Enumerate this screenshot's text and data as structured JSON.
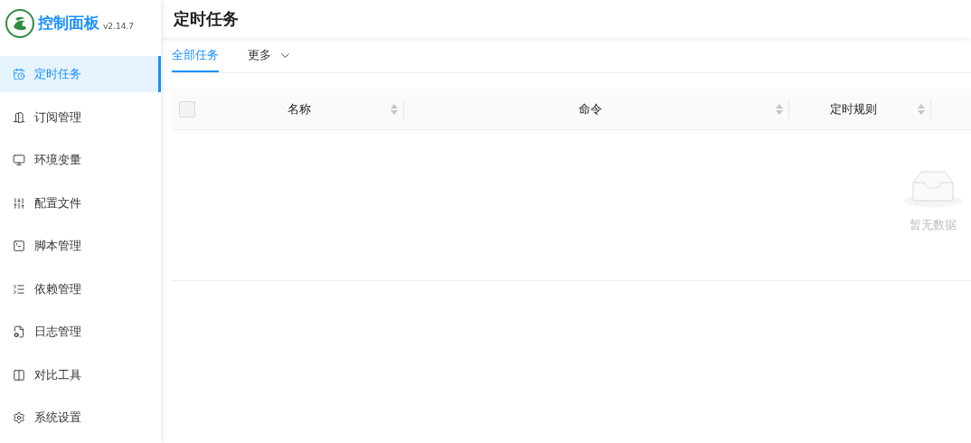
{
  "app": {
    "name": "控制面板",
    "version": "v2.14.7"
  },
  "sidebar": {
    "items": [
      {
        "label": "定时任务",
        "selected": true
      },
      {
        "label": "订阅管理",
        "selected": false
      },
      {
        "label": "环境变量",
        "selected": false
      },
      {
        "label": "配置文件",
        "selected": false
      },
      {
        "label": "脚本管理",
        "selected": false
      },
      {
        "label": "依赖管理",
        "selected": false
      },
      {
        "label": "日志管理",
        "selected": false
      },
      {
        "label": "对比工具",
        "selected": false
      },
      {
        "label": "系统设置",
        "selected": false
      }
    ]
  },
  "page": {
    "title": "定时任务"
  },
  "tabs": [
    {
      "label": "全部任务",
      "selected": true
    },
    {
      "label": "更多",
      "selected": false,
      "kind": "dropdown"
    }
  ],
  "table": {
    "select_all": {
      "checked": false
    },
    "columns": [
      {
        "label": "名称"
      },
      {
        "label": "命令"
      },
      {
        "label": "定时规则"
      }
    ],
    "empty_text": "暂无数据"
  }
}
